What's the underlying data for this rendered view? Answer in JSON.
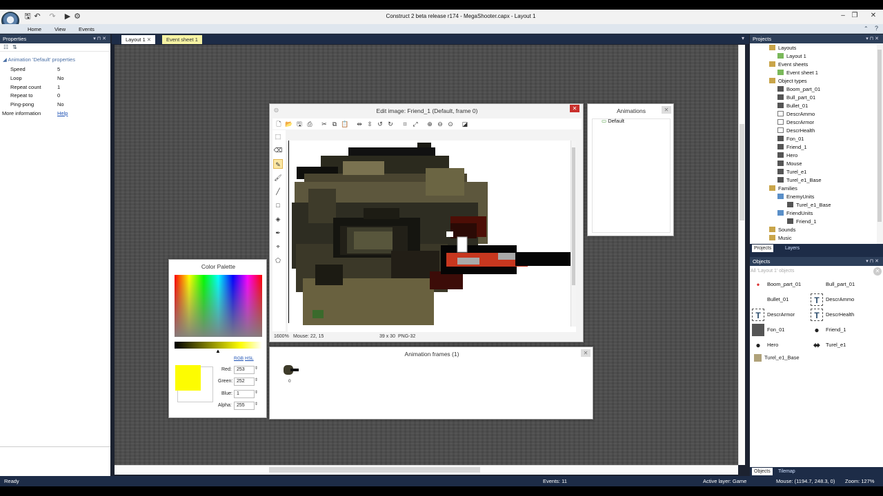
{
  "window": {
    "title": "Construct 2 beta release r174 - MegaShooter.capx - Layout 1",
    "controls": [
      "–",
      "❐",
      "✕"
    ]
  },
  "ribbon": {
    "tabs": [
      "Home",
      "View",
      "Events"
    ]
  },
  "properties_panel": {
    "title": "Properties",
    "section": "Animation 'Default' properties",
    "rows": [
      {
        "label": "Speed",
        "value": "5"
      },
      {
        "label": "Loop",
        "value": "No"
      },
      {
        "label": "Repeat count",
        "value": "1"
      },
      {
        "label": "Repeat to",
        "value": "0"
      },
      {
        "label": "Ping-pong",
        "value": "No"
      }
    ],
    "more_info_label": "More information",
    "more_info_link": "Help"
  },
  "doc_tabs": [
    "Layout 1",
    "Event sheet 1"
  ],
  "edit_image": {
    "title": "Edit image: Friend_1 (Default, frame 0)",
    "status_zoom": "1600%",
    "status_mouse": "Mouse: 22, 15",
    "status_size": "39 x 30",
    "status_format": "PNG-32"
  },
  "animations_panel": {
    "title": "Animations",
    "items": [
      "Default"
    ]
  },
  "animation_frames": {
    "title": "Animation frames (1)",
    "frames": [
      "0"
    ]
  },
  "color_palette": {
    "title": "Color Palette",
    "mode_rgb": "RGB",
    "mode_hsl": "HSL",
    "red_label": "Red:",
    "red": "253",
    "green_label": "Green:",
    "green": "252",
    "blue_label": "Blue:",
    "blue": "1",
    "alpha_label": "Alpha:",
    "alpha": "255",
    "swatch_color": "#fdfc01"
  },
  "projects_panel": {
    "title": "Projects",
    "tree": [
      {
        "label": "Layouts",
        "level": 0
      },
      {
        "label": "Layout 1",
        "level": 1
      },
      {
        "label": "Event sheets",
        "level": 0
      },
      {
        "label": "Event sheet 1",
        "level": 1
      },
      {
        "label": "Object types",
        "level": 0
      },
      {
        "label": "Boom_part_01",
        "level": 1
      },
      {
        "label": "Bull_part_01",
        "level": 1
      },
      {
        "label": "Bullet_01",
        "level": 1
      },
      {
        "label": "DescrAmmo",
        "level": 1
      },
      {
        "label": "DescrArmor",
        "level": 1
      },
      {
        "label": "DescrHealth",
        "level": 1
      },
      {
        "label": "Fon_01",
        "level": 1
      },
      {
        "label": "Friend_1",
        "level": 1
      },
      {
        "label": "Hero",
        "level": 1
      },
      {
        "label": "Mouse",
        "level": 1
      },
      {
        "label": "Turel_e1",
        "level": 1
      },
      {
        "label": "Turel_e1_Base",
        "level": 1
      },
      {
        "label": "Families",
        "level": 0
      },
      {
        "label": "EnemyUnits",
        "level": 1
      },
      {
        "label": "Turel_e1_Base",
        "level": 2
      },
      {
        "label": "FriendUnits",
        "level": 1
      },
      {
        "label": "Friend_1",
        "level": 2
      },
      {
        "label": "Sounds",
        "level": 0
      },
      {
        "label": "Music",
        "level": 0
      }
    ],
    "tabs": [
      "Projects",
      "Layers"
    ]
  },
  "objects_panel": {
    "title": "Objects",
    "filter_placeholder": "All 'Layout 1' objects",
    "items": [
      "Boom_part_01",
      "Bull_part_01",
      "Bullet_01",
      "DescrAmmo",
      "DescrArmor",
      "DescrHealth",
      "Fon_01",
      "Friend_1",
      "Hero",
      "Turel_e1",
      "Turel_e1_Base"
    ],
    "tabs": [
      "Objects",
      "Tilemap"
    ]
  },
  "status_bar": {
    "ready": "Ready",
    "events": "Events: 11",
    "active_layer": "Active layer: Game",
    "mouse": "Mouse: (1194.7, 248.3, 0)",
    "zoom": "Zoom: 127%"
  }
}
